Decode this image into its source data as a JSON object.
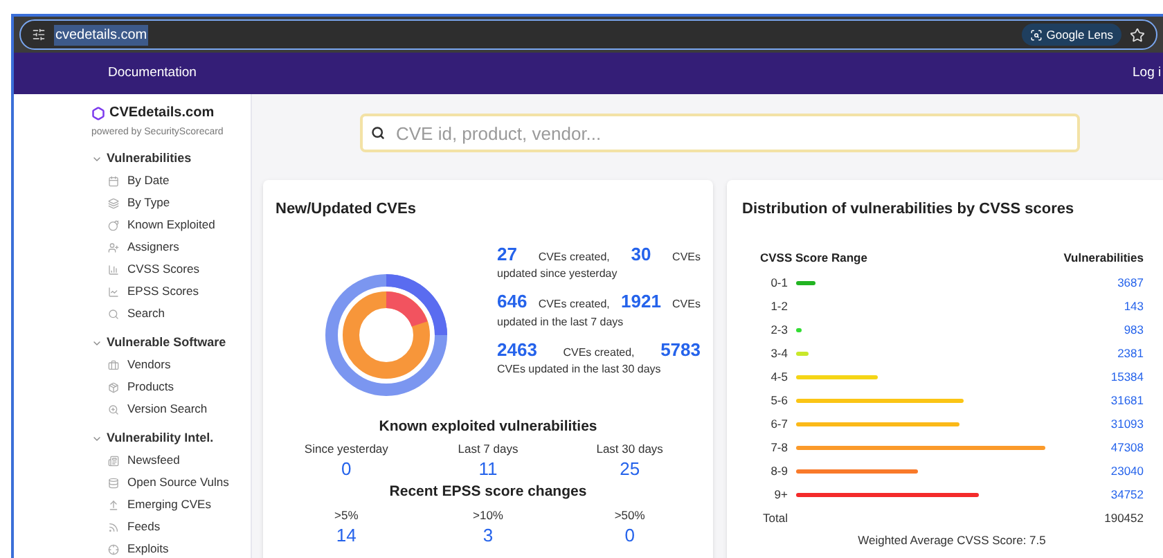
{
  "browser": {
    "url": "cvedetails.com",
    "lens_button": "Google Lens"
  },
  "nav": {
    "links": [
      "Documentation"
    ],
    "login": "Log i"
  },
  "sidebar": {
    "logo": "CVEdetails.com",
    "tagline": "powered by SecurityScorecard",
    "sections": [
      {
        "title": "Vulnerabilities",
        "expanded": true,
        "items": [
          "By Date",
          "By Type",
          "Known Exploited",
          "Assigners",
          "CVSS Scores",
          "EPSS Scores",
          "Search"
        ]
      },
      {
        "title": "Vulnerable Software",
        "expanded": true,
        "items": [
          "Vendors",
          "Products",
          "Version Search"
        ]
      },
      {
        "title": "Vulnerability Intel.",
        "expanded": true,
        "items": [
          "Newsfeed",
          "Open Source Vulns",
          "Emerging CVEs",
          "Feeds",
          "Exploits"
        ]
      }
    ]
  },
  "search": {
    "placeholder": "CVE id, product, vendor..."
  },
  "new_updated": {
    "title": "New/Updated CVEs",
    "stats": [
      {
        "created": "27",
        "created_label": "CVEs created,",
        "updated": "30",
        "updated_label": "CVEs",
        "tail": "updated since yesterday"
      },
      {
        "created": "646",
        "created_label": "CVEs created,",
        "updated": "1921",
        "updated_label": "CVEs",
        "tail": "updated in the last 7 days"
      },
      {
        "created": "2463",
        "created_label": "CVEs created,",
        "updated": "5783",
        "tail": "CVEs updated in the last 30 days"
      }
    ],
    "known_exploited": {
      "title": "Known exploited vulnerabilities",
      "periods": [
        {
          "label": "Since yesterday",
          "value": "0"
        },
        {
          "label": "Last 7 days",
          "value": "11"
        },
        {
          "label": "Last 30 days",
          "value": "25"
        }
      ]
    },
    "epss": {
      "title": "Recent EPSS score changes",
      "periods": [
        {
          "label": ">5%",
          "value": "14"
        },
        {
          "label": ">10%",
          "value": "3"
        },
        {
          "label": ">50%",
          "value": "0"
        }
      ]
    }
  },
  "distribution": {
    "title": "Distribution of vulnerabilities by CVSS scores",
    "columns": [
      "CVSS Score Range",
      "Vulnerabilities"
    ],
    "rows": [
      {
        "range": "0-1",
        "count": "3687",
        "color": "#22b422"
      },
      {
        "range": "1-2",
        "count": "143"
      },
      {
        "range": "2-3",
        "count": "983",
        "color": "#33dd33"
      },
      {
        "range": "3-4",
        "count": "2381",
        "color": "#c8e82a"
      },
      {
        "range": "4-5",
        "count": "15384",
        "color": "#f5d516"
      },
      {
        "range": "5-6",
        "count": "31681",
        "color": "#fbc515"
      },
      {
        "range": "6-7",
        "count": "31093",
        "color": "#fbb918"
      },
      {
        "range": "7-8",
        "count": "47308",
        "color": "#fb9a2a"
      },
      {
        "range": "8-9",
        "count": "23040",
        "color": "#f97a2a"
      },
      {
        "range": "9+",
        "count": "34752",
        "color": "#f42a2a"
      }
    ],
    "total_label": "Total",
    "total": "190452",
    "average": "Weighted Average CVSS Score: 7.5"
  }
}
